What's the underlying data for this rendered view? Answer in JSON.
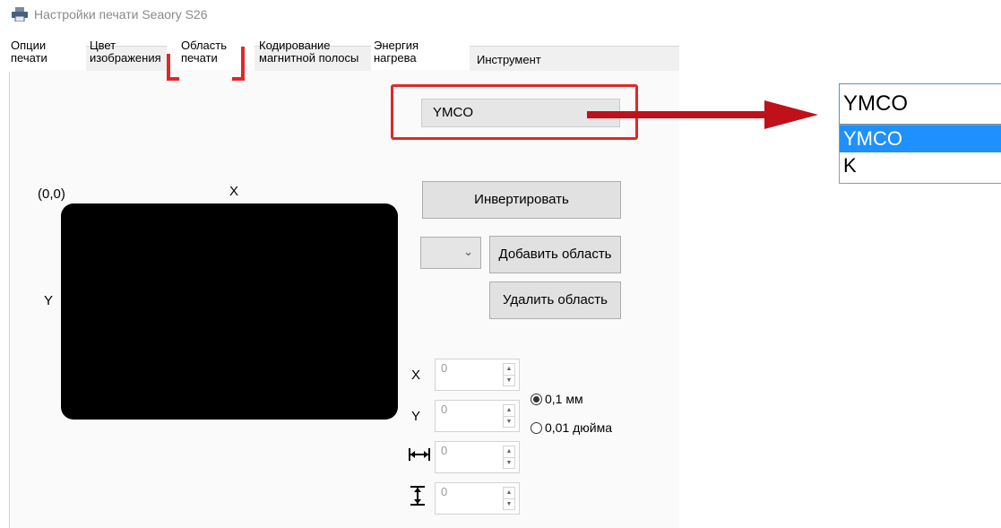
{
  "window": {
    "title": "Настройки печати Seaory S26"
  },
  "tabs": [
    {
      "line1": "Опции",
      "line2": "печати"
    },
    {
      "line1": "Цвет",
      "line2": "изображения"
    },
    {
      "line1": "Область",
      "line2": "печати"
    },
    {
      "line1": "Кодирование",
      "line2": "магнитной полосы"
    },
    {
      "line1": "Энергия",
      "line2": "нагрева"
    },
    {
      "line1": "Инструмент",
      "line2": ""
    }
  ],
  "active_tab_index": 2,
  "print_mode": {
    "value": "YMCO",
    "dropdown": {
      "value": "YMCO",
      "options": [
        "YMCO",
        "K"
      ],
      "selected": "YMCO"
    }
  },
  "card": {
    "origin_label": "(0,0)",
    "x_label": "X",
    "y_label": "Y"
  },
  "buttons": {
    "invert": "Инвертировать",
    "add_area": "Добавить область",
    "delete_area": "Удалить область"
  },
  "coords": {
    "x": {
      "label": "X",
      "value": "0"
    },
    "y": {
      "label": "Y",
      "value": "0"
    },
    "width": {
      "value": "0"
    },
    "height": {
      "value": "0"
    }
  },
  "units": {
    "option1": "0,1 мм",
    "option2": "0,01 дюйма",
    "selected": "0,1 мм"
  },
  "colors": {
    "highlight": "#e02828",
    "selection": "#1e90ff",
    "arrow": "#c0101a"
  }
}
